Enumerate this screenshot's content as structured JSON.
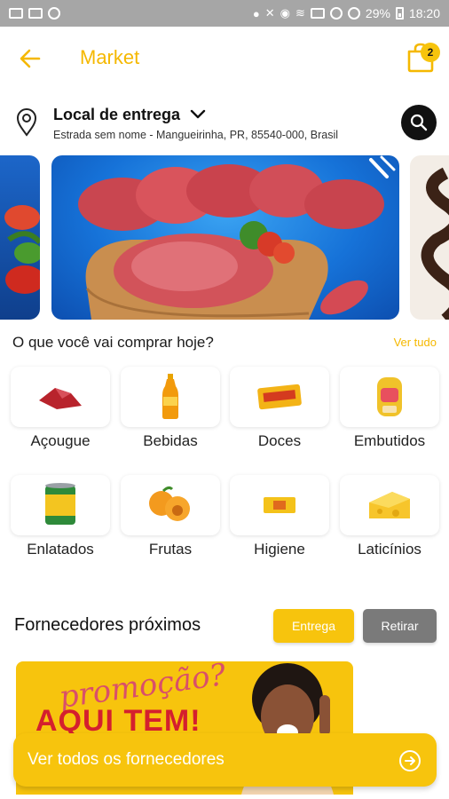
{
  "status_bar": {
    "battery": "29%",
    "time": "18:20"
  },
  "header": {
    "title": "Market",
    "cart_count": "2"
  },
  "location": {
    "title": "Local de entrega",
    "address": "Estrada sem nome - Mangueirinha, PR, 85540-000, Brasil"
  },
  "categories": {
    "heading": "O que você vai comprar hoje?",
    "see_all": "Ver tudo",
    "items": [
      {
        "label": "Açougue",
        "icon": "meat-icon"
      },
      {
        "label": "Bebidas",
        "icon": "bottle-icon"
      },
      {
        "label": "Doces",
        "icon": "candy-icon"
      },
      {
        "label": "Embutidos",
        "icon": "sausage-icon"
      },
      {
        "label": "Enlatados",
        "icon": "can-icon"
      },
      {
        "label": "Frutas",
        "icon": "fruit-icon"
      },
      {
        "label": "Higiene",
        "icon": "soap-icon"
      },
      {
        "label": "Laticínios",
        "icon": "cheese-icon"
      }
    ]
  },
  "suppliers": {
    "title": "Fornecedores próximos",
    "delivery_label": "Entrega",
    "pickup_label": "Retirar",
    "promo_script": "promoção?",
    "promo_headline": "AQUI TEM!",
    "cta_label": "Ver todos os fornecedores"
  },
  "colors": {
    "accent": "#f7c40d",
    "title_yellow": "#f5b800",
    "grey_button": "#7a7a7a"
  }
}
